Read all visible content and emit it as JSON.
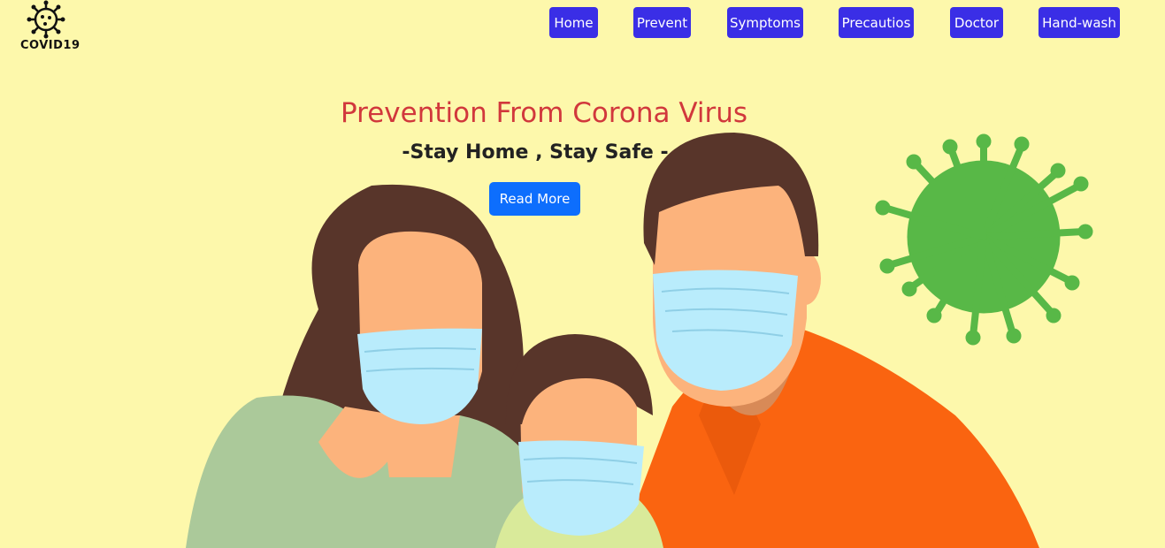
{
  "brand": {
    "logo_text": "COVID19"
  },
  "nav": {
    "items": [
      {
        "label": "Home"
      },
      {
        "label": "Prevent"
      },
      {
        "label": "Symptoms"
      },
      {
        "label": "Precautios"
      },
      {
        "label": "Doctor"
      },
      {
        "label": "Hand-wash"
      }
    ]
  },
  "hero": {
    "title": "Prevention From Corona Virus",
    "subtitle": "-Stay Home , Stay Safe -",
    "button_label": "Read More"
  },
  "colors": {
    "background": "#fdf8ab",
    "nav_button": "#3a2ee6",
    "title": "#d1383c",
    "primary_button": "#0d6efd",
    "virus": "#58b847"
  },
  "illustration": {
    "subject": "family-with-masks",
    "decor": "coronavirus-icon"
  }
}
